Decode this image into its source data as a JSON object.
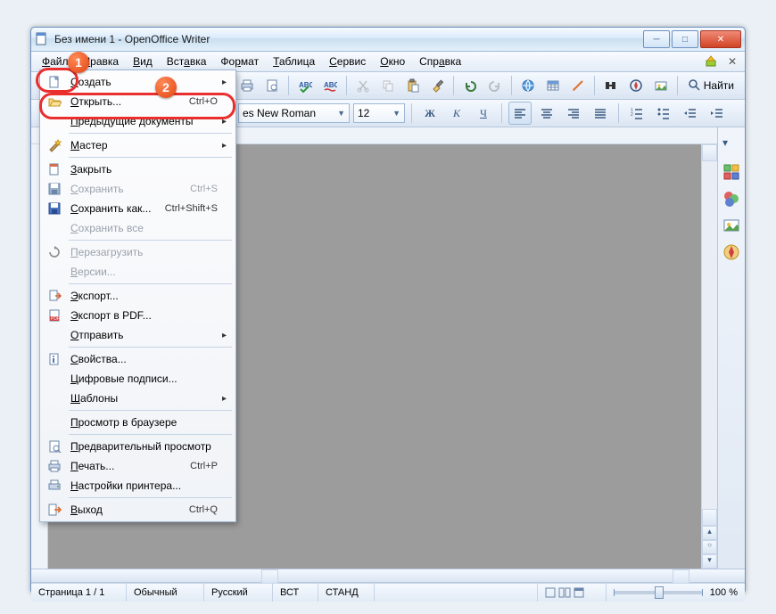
{
  "title": "Без имени 1 - OpenOffice Writer",
  "menubar": [
    "Файл",
    "Правка",
    "Вид",
    "Вставка",
    "Формат",
    "Таблица",
    "Сервис",
    "Окно",
    "Справка"
  ],
  "find_label": "Найти",
  "format_bar": {
    "font_family": "es New Roman",
    "font_size": "12",
    "bold": "Ж",
    "italic": "К",
    "underline": "Ч"
  },
  "file_menu": [
    {
      "icon": "new",
      "label": "Создать",
      "short": "",
      "sub": true
    },
    {
      "icon": "open",
      "label": "Открыть...",
      "short": "Ctrl+O",
      "sub": false,
      "hl": true
    },
    {
      "icon": "",
      "label": "Предыдущие документы",
      "short": "",
      "sub": true
    },
    {
      "sep": true
    },
    {
      "icon": "wizard",
      "label": "Мастер",
      "short": "",
      "sub": true
    },
    {
      "sep": true
    },
    {
      "icon": "close",
      "label": "Закрыть",
      "short": "",
      "sub": false
    },
    {
      "icon": "save",
      "label": "Сохранить",
      "short": "Ctrl+S",
      "sub": false,
      "disabled": true
    },
    {
      "icon": "saveas",
      "label": "Сохранить как...",
      "short": "Ctrl+Shift+S",
      "sub": false
    },
    {
      "icon": "",
      "label": "Сохранить все",
      "short": "",
      "sub": false,
      "disabled": true
    },
    {
      "sep": true
    },
    {
      "icon": "reload",
      "label": "Перезагрузить",
      "short": "",
      "sub": false,
      "disabled": true
    },
    {
      "icon": "",
      "label": "Версии...",
      "short": "",
      "sub": false,
      "disabled": true
    },
    {
      "sep": true
    },
    {
      "icon": "export",
      "label": "Экспорт...",
      "short": "",
      "sub": false
    },
    {
      "icon": "pdf",
      "label": "Экспорт в PDF...",
      "short": "",
      "sub": false
    },
    {
      "icon": "",
      "label": "Отправить",
      "short": "",
      "sub": true
    },
    {
      "sep": true
    },
    {
      "icon": "props",
      "label": "Свойства...",
      "short": "",
      "sub": false
    },
    {
      "icon": "",
      "label": "Цифровые подписи...",
      "short": "",
      "sub": false
    },
    {
      "icon": "",
      "label": "Шаблоны",
      "short": "",
      "sub": true
    },
    {
      "sep": true
    },
    {
      "icon": "",
      "label": "Просмотр в браузере",
      "short": "",
      "sub": false
    },
    {
      "sep": true
    },
    {
      "icon": "preview",
      "label": "Предварительный просмотр",
      "short": "",
      "sub": false
    },
    {
      "icon": "print",
      "label": "Печать...",
      "short": "Ctrl+P",
      "sub": false
    },
    {
      "icon": "printer",
      "label": "Настройки принтера...",
      "short": "",
      "sub": false
    },
    {
      "sep": true
    },
    {
      "icon": "exit",
      "label": "Выход",
      "short": "Ctrl+Q",
      "sub": false
    }
  ],
  "status": {
    "page": "Страница 1 / 1",
    "style": "Обычный",
    "lang": "Русский",
    "insert": "ВСТ",
    "std": "СТАНД",
    "zoom": "100 %"
  },
  "annotations": {
    "badge1": "1",
    "badge2": "2"
  }
}
